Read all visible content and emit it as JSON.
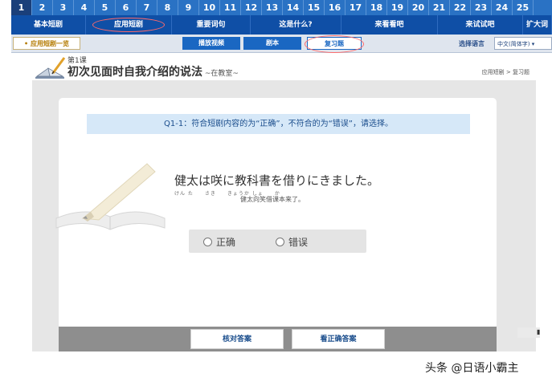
{
  "lesson_numbers": [
    "1",
    "2",
    "3",
    "4",
    "5",
    "6",
    "7",
    "8",
    "9",
    "10",
    "11",
    "12",
    "13",
    "14",
    "15",
    "16",
    "17",
    "18",
    "19",
    "20",
    "21",
    "22",
    "23",
    "24",
    "25"
  ],
  "active_lesson": "1",
  "top_nav": [
    {
      "label": "基本短剧",
      "active": false
    },
    {
      "label": "应用短剧",
      "active": true
    },
    {
      "label": "重要词句",
      "active": false
    },
    {
      "label": "这是什么?",
      "active": false
    },
    {
      "label": "来看看吧",
      "active": false
    },
    {
      "label": "来试试吧",
      "active": false
    },
    {
      "label": "扩大词语",
      "active": false
    }
  ],
  "sub_nav": {
    "current": "• 应用短剧一览",
    "tabs": [
      {
        "label": "播放视频",
        "active": false
      },
      {
        "label": "剧本",
        "active": false
      },
      {
        "label": "复习题",
        "active": true
      }
    ],
    "language_label": "选择语言",
    "language_value": "中文(简体字)"
  },
  "title": {
    "lesson": "第1课",
    "main": "初次见面时自我介绍的说法",
    "sub": " ~在教室~"
  },
  "breadcrumb": "应用短剧 > 复习题",
  "question": {
    "prompt": "Q1-1：符合短剧内容的为“正确”，不符合的为“错误”，请选择。",
    "sentence": "健太は咲に教科書を借りにきました。",
    "furigana": "けん た　　さき　　きょうか しょ　　か",
    "translation": "健太向笑借课本来了。",
    "choices": [
      "正确",
      "错误"
    ]
  },
  "buttons": {
    "check": "核对答案",
    "answer": "看正确答案"
  },
  "side_tab_glyph": "▮",
  "watermark": "头条 @日语小霸主",
  "colors": {
    "strip": "#2a72c4",
    "nav": "#0f4fa6",
    "accent": "#1a67c2",
    "highlight_circle": "#ff6a6a",
    "question_bar": "#d6e8f8"
  }
}
